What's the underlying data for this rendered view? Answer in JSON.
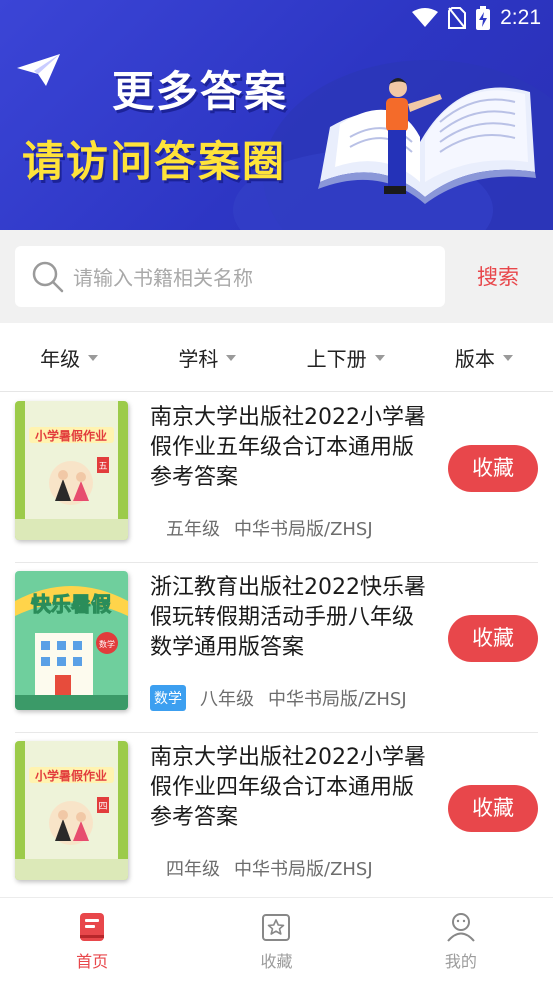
{
  "status_bar": {
    "time": "2:21"
  },
  "banner": {
    "line1": "更多答案",
    "line2": "请访问答案圈"
  },
  "search": {
    "placeholder": "请输入书籍相关名称",
    "button": "搜索"
  },
  "filters": [
    "年级",
    "学科",
    "上下册",
    "版本"
  ],
  "books": [
    {
      "title": "南京大学出版社2022小学暑假作业五年级合订本通用版参考答案",
      "tag": "",
      "grade": "五年级",
      "edition": "中华书局版/ZHSJ",
      "action": "收藏",
      "cover_text": "小学暑假作业",
      "cover_badge": "五"
    },
    {
      "title": "浙江教育出版社2022快乐暑假玩转假期活动手册八年级数学通用版答案",
      "tag": "数学",
      "grade": "八年级",
      "edition": "中华书局版/ZHSJ",
      "action": "收藏",
      "cover_text": "快乐暑假",
      "cover_badge": "数学"
    },
    {
      "title": "南京大学出版社2022小学暑假作业四年级合订本通用版参考答案",
      "tag": "",
      "grade": "四年级",
      "edition": "中华书局版/ZHSJ",
      "action": "收藏",
      "cover_text": "小学暑假作业",
      "cover_badge": "四"
    }
  ],
  "nav": {
    "items": [
      {
        "label": "首页",
        "icon": "home-book-icon",
        "active": true
      },
      {
        "label": "收藏",
        "icon": "star-box-icon",
        "active": false
      },
      {
        "label": "我的",
        "icon": "user-icon",
        "active": false
      }
    ]
  },
  "colors": {
    "accent": "#e8474b",
    "banner_bg": "#3340c8",
    "tag_blue": "#3c9ff0"
  }
}
